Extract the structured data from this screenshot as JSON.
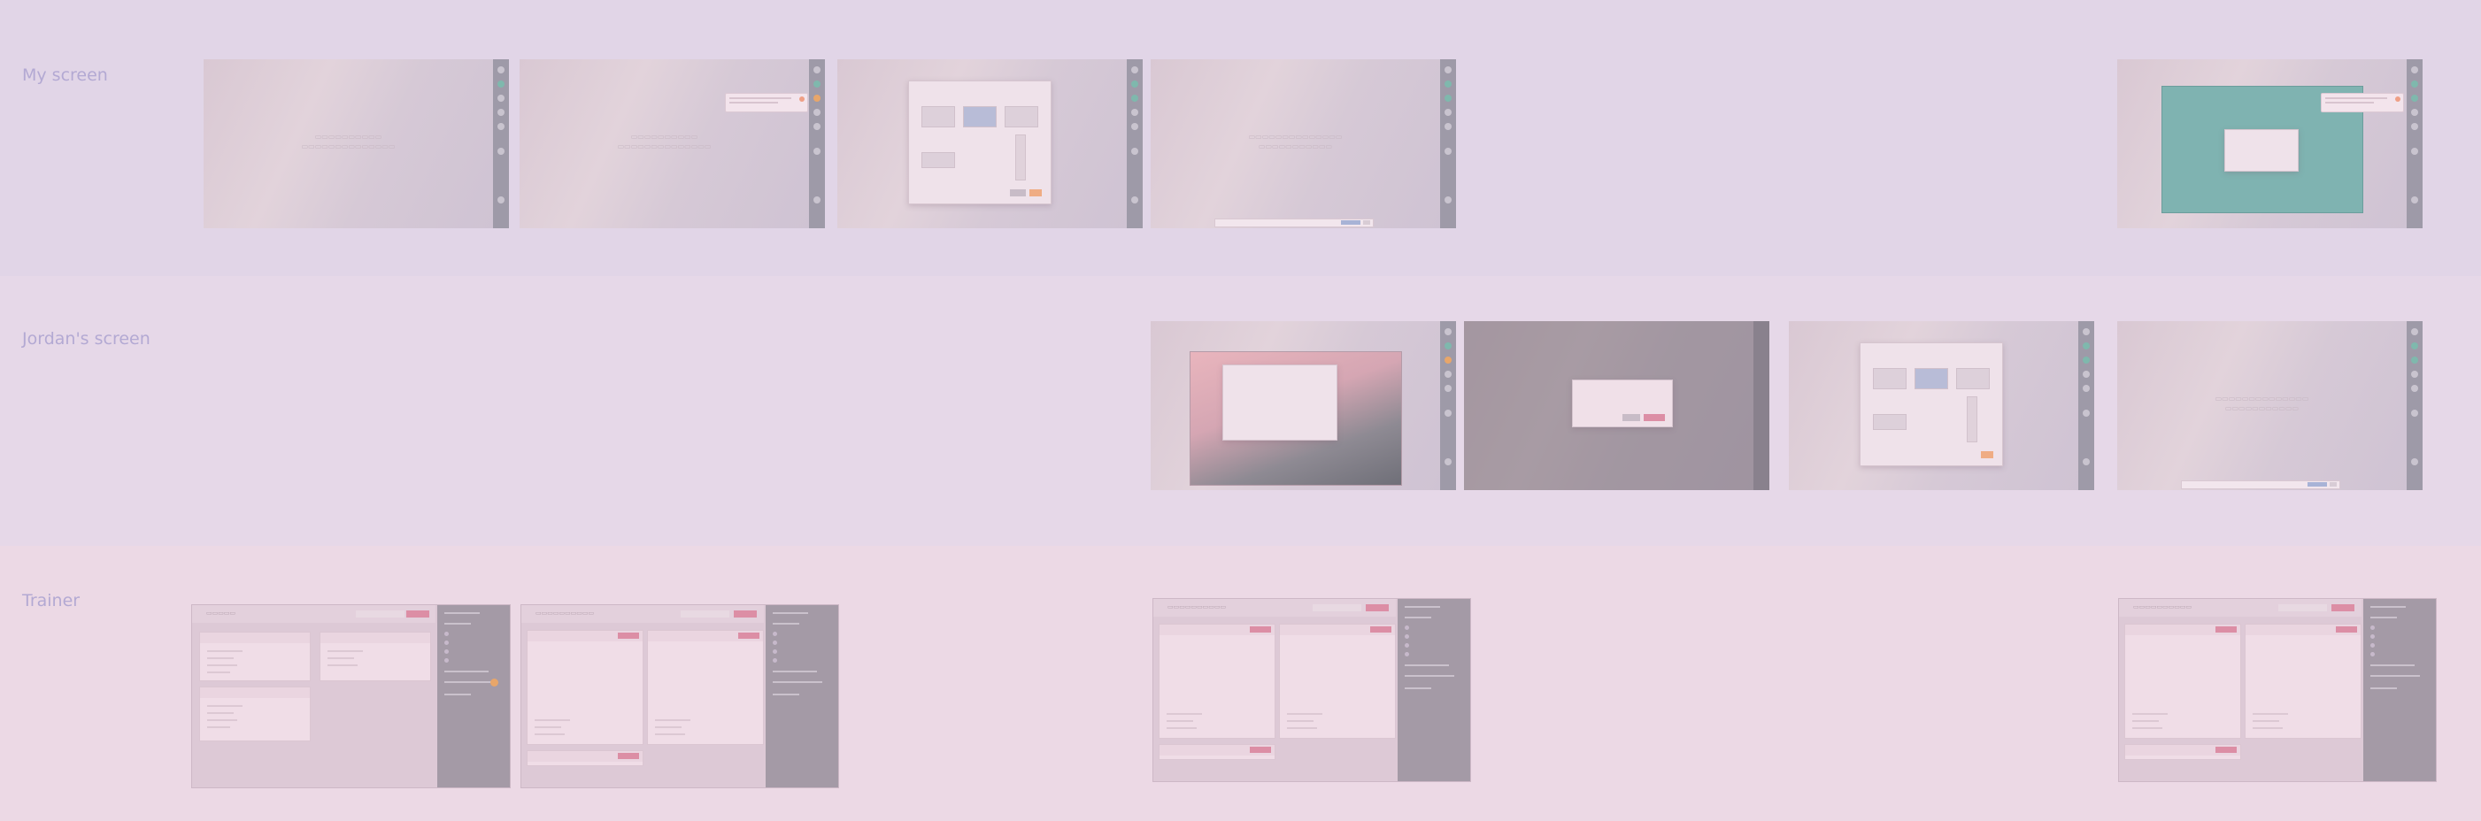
{
  "rows": [
    {
      "label": "My screen"
    },
    {
      "label": "Jordan's screen"
    },
    {
      "label": "Trainer"
    }
  ],
  "colors": {
    "band_my_screen": "#e1d5e7",
    "band_jordan": "#e6d8e8",
    "band_trainer": "#ecd9e5",
    "label_text": "#b3a9d3",
    "accent_pink": "#dc8ea5",
    "accent_green": "#7fb8ad",
    "accent_orange": "#e8a66a"
  },
  "icons": {
    "rail": "sidebar-dot-icon",
    "close": "close-icon"
  }
}
